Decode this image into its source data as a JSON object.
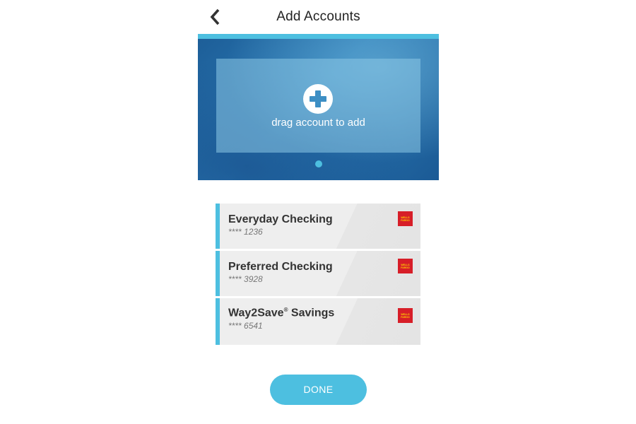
{
  "header": {
    "title": "Add Accounts",
    "back_icon": "chevron-left-icon"
  },
  "hero": {
    "drop_label": "drag account to add",
    "add_icon": "plus-circle-icon",
    "pager": {
      "pages": 1,
      "current": 1
    }
  },
  "accounts": [
    {
      "name": "Everyday Checking",
      "trademark": "",
      "number": "**** 1236",
      "bank_logo": "WELLS FARGO"
    },
    {
      "name": "Preferred Checking",
      "trademark": "",
      "number": "**** 3928",
      "bank_logo": "WELLS FARGO"
    },
    {
      "name": "Way2Save",
      "trademark": "®",
      "name_suffix": " Savings",
      "number": "**** 6541",
      "bank_logo": "WELLS FARGO"
    }
  ],
  "done_label": "DONE",
  "colors": {
    "accent": "#4dbfe0",
    "hero_blue": "#1d5e98",
    "card_bg": "#eeeeee",
    "logo_red": "#d71e28",
    "logo_text": "#ffd200"
  }
}
